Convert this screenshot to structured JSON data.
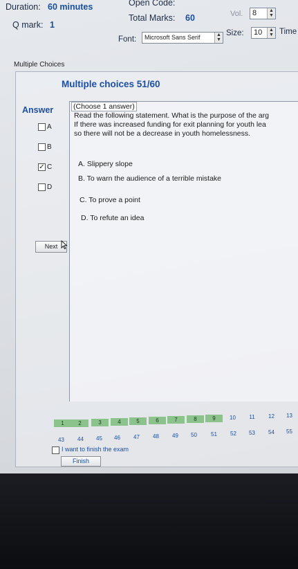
{
  "header": {
    "duration_label": "Duration:",
    "duration_value": "60 minutes",
    "open_code_label": "Open Code:",
    "qmark_label": "Q mark:",
    "qmark_value": "1",
    "total_marks_label": "Total Marks:",
    "total_marks_value": "60",
    "vol_label": "Vol.",
    "vol_value": "8",
    "font_label": "Font:",
    "font_value": "Microsoft Sans Serif",
    "size_label": "Size:",
    "size_value": "10",
    "time_label": "Time"
  },
  "tab_label": "Multiple Choices",
  "panel_title": "Multiple choices 51/60",
  "answer_label": "Answer",
  "answers": [
    {
      "letter": "A",
      "checked": false
    },
    {
      "letter": "B",
      "checked": false
    },
    {
      "letter": "C",
      "checked": true
    },
    {
      "letter": "D",
      "checked": false
    }
  ],
  "question": {
    "instruction": "(Choose 1 answer)",
    "line1": "Read the following statement. What is the purpose of the arg",
    "line2": "If there was increased funding for exit planning for youth lea",
    "line3": "so there will not be a decrease in youth homelessness.",
    "options": [
      "A. Slippery slope",
      "B. To warn the audience of a terrible mistake",
      "C. To prove a point",
      "D. To refute an idea"
    ]
  },
  "next_button": "Next",
  "question_nav": {
    "row1": [
      "1",
      "2",
      "3",
      "4",
      "5",
      "6",
      "7",
      "8",
      "9",
      "10",
      "11",
      "12",
      "13"
    ],
    "row2": [
      "43",
      "44",
      "45",
      "46",
      "47",
      "48",
      "49",
      "50",
      "51",
      "52",
      "53",
      "54",
      "55"
    ],
    "answered_row1": 9
  },
  "finish_checkbox_label": "I want to finish the exam",
  "finish_button": "Finish"
}
